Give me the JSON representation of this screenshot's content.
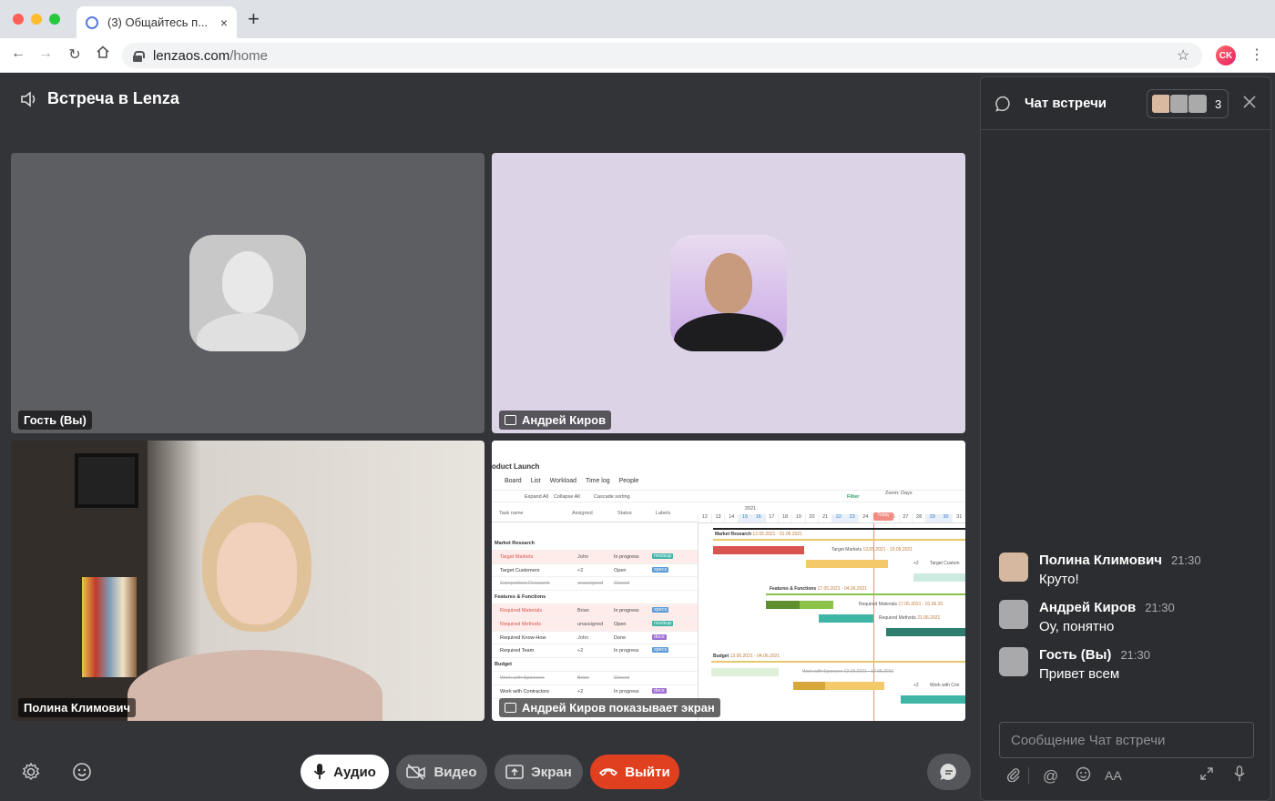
{
  "browser": {
    "tab_title": "(3) Общайтесь п...",
    "url_domain": "lenzaos.com",
    "url_path": "/home",
    "profile_initials": "CK",
    "close_tab": "×",
    "new_tab": "+"
  },
  "meeting": {
    "title": "Встреча в Lenza"
  },
  "tiles": {
    "guest_label": "Гость (Вы)",
    "andrey_label": "Андрей Киров",
    "polina_label": "Полина Климович",
    "screen_label": "Андрей Киров показывает экран"
  },
  "screen_share": {
    "project": "oduct Launch",
    "tabs": [
      "Board",
      "List",
      "Workload",
      "Time log",
      "People"
    ],
    "toolbar": [
      "Expand All",
      "Collapse All",
      "Cascade sorting",
      "Filter",
      "Zoom: Days"
    ],
    "columns": [
      "Task name",
      "Assigned",
      "Status",
      "Labels"
    ],
    "year": "2021",
    "days": [
      "12",
      "13",
      "14",
      "15",
      "16",
      "17",
      "18",
      "19",
      "20",
      "21",
      "22",
      "23",
      "24",
      "25",
      "26",
      "27",
      "28",
      "29",
      "30",
      "31"
    ],
    "rows": [
      {
        "task": "Market Research",
        "assigned": "",
        "status": "",
        "label": ""
      },
      {
        "task": "Target Markets",
        "assigned": "John",
        "status": "In progress",
        "label": "mockup"
      },
      {
        "task": "Target Customers",
        "assigned": "+2",
        "status": "Open",
        "label": "specs"
      },
      {
        "task": "Competitors Research",
        "assigned": "unassigned",
        "status": "Closed",
        "label": ""
      },
      {
        "task": "Features & Functions",
        "assigned": "",
        "status": "",
        "label": ""
      },
      {
        "task": "Required Materials",
        "assigned": "Brian",
        "status": "In progress",
        "label": "specs"
      },
      {
        "task": "Required Methods",
        "assigned": "unassigned",
        "status": "Open",
        "label": "mockup"
      },
      {
        "task": "Required Know-How",
        "assigned": "John",
        "status": "Done",
        "label": "docs"
      },
      {
        "task": "Required Team",
        "assigned": "+2",
        "status": "In progress",
        "label": "specs"
      },
      {
        "task": "Budget",
        "assigned": "",
        "status": "",
        "label": ""
      },
      {
        "task": "Work with Sponsors",
        "assigned": "Brian",
        "status": "Closed",
        "label": ""
      },
      {
        "task": "Work with Contractors",
        "assigned": "+2",
        "status": "In progress",
        "label": "docs"
      }
    ],
    "bar_labels": {
      "market": "Market Research",
      "market_dates": "12.05.2021 - 01.06.2021",
      "features": "Features & Functions",
      "features_dates": "17.05.2021 - 04.06.2021",
      "budget": "Budget",
      "budget_dates": "13.05.2021 - 04.06.2021",
      "target_markets": "Target Markets",
      "target_markets_dates": "13.05.2021 - 19.05.2021",
      "target_customers": "Target Custom",
      "req_materials": "Required Materials",
      "req_materials_dates": "17.05.2021 - 01.06.20",
      "req_methods": "Required Methods",
      "req_methods_dates": "21.06.2021",
      "work_sponsors": "Work with Sponsors",
      "work_sponsors_dates": "12.05.2021 - 17.05.2021",
      "work_contractors": "Work with Con",
      "today": "Today",
      "plus2": "+2"
    }
  },
  "controls": {
    "audio": "Аудио",
    "video": "Видео",
    "screen": "Экран",
    "leave": "Выйти"
  },
  "chat": {
    "title": "Чат встречи",
    "participant_count": "3",
    "messages": [
      {
        "name": "Полина Климович",
        "time": "21:30",
        "text": "Круто!"
      },
      {
        "name": "Андрей Киров",
        "time": "21:30",
        "text": "Оу, понятно"
      },
      {
        "name": "Гость (Вы)",
        "time": "21:30",
        "text": "Привет всем"
      }
    ],
    "input_placeholder": "Сообщение Чат встречи",
    "format_label": "AA"
  }
}
